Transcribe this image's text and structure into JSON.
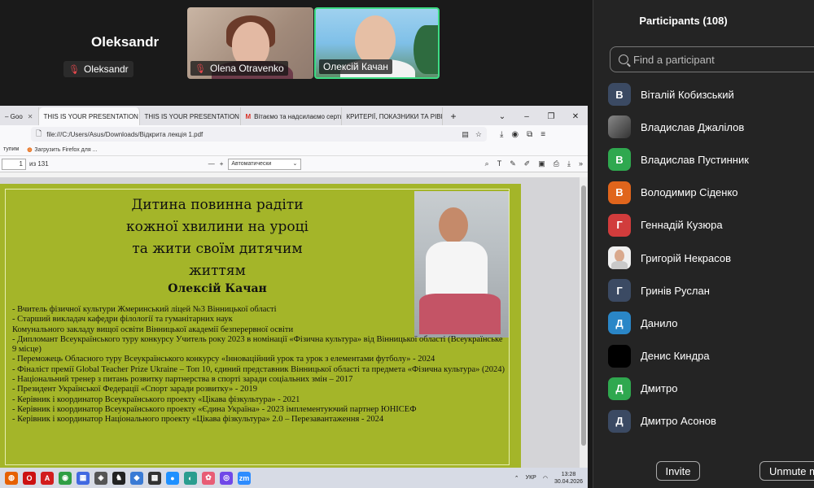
{
  "meeting": {
    "self_name_large": "Oleksandr",
    "self_name_tag": "Oleksandr",
    "tiles": [
      {
        "name": "Olena Otravenko",
        "muted": true
      },
      {
        "name": "Олексій Качан",
        "muted": false,
        "active_speaker": true
      }
    ]
  },
  "browser": {
    "tabs": [
      {
        "label": "– Goo"
      },
      {
        "label": "THIS IS YOUR PRESENTATION TITLE",
        "active": true
      },
      {
        "label": "THIS IS YOUR PRESENTATION TITLE"
      },
      {
        "label": "Вітаємо та надсилаємо сертиф",
        "icon": "M"
      },
      {
        "label": "КРИТЕРІЇ, ПОКАЗНИКИ ТА РІВНІ С"
      }
    ],
    "url": "file:///C:/Users/Asus/Downloads/Відкрита лекція 1.pdf",
    "bookmarks": [
      "тупим",
      "Загрузить Firefox для ..."
    ],
    "pdf": {
      "page_current": "1",
      "page_total": "из 131",
      "zoom": "Автоматически"
    }
  },
  "slide": {
    "title_lines": [
      "Дитина повинна радіти",
      "кожної хвилини на уроці",
      "та жити своїм дитячим",
      "життям"
    ],
    "author": "Олексій Качан",
    "bullets": [
      "- Вчитель фізичної культури Жмеринський ліцей №3 Вінницької області",
      "- Старший викладач кафедри філології та гуманітарних наук",
      "Комунального закладу вищої освіти Вінницької академії безперервної освіти",
      "- Дипломант Всеукраїнського туру конкурсу Учитель року 2023 в номінації «Фізична культура» від Вінницької області (Всеукраїнське 9 місце)",
      "- Переможець Обласного туру Всеукраїнського конкурсу «Інноваційний урок та урок з елементами футболу» - 2024",
      "- Фіналіст премії Global Teacher Prize Ukraine – Топ 10, єдиний представник Вінницької області та предмета «Фізична культура» (2024)",
      "- Національний тренер з питань розвитку партнерства в спорті заради соціальних змін – 2017",
      "- Президент Української Федерації «Спорт заради розвитку» - 2019",
      "- Керівник і координатор Всеукраїнського проекту «Цікава фізкультура» - 2021",
      "- Керівник і координатор Всеукраїнського проекту «Єдина Україна» - 2023 імплементуючий партнер ЮНІСЕФ",
      "- Керівник і координатор Національного проекту «Цікава фізкультура» 2.0 – Перезавантаження - 2024"
    ]
  },
  "taskbar": {
    "lang": "УКР",
    "time": "13:28",
    "date": "30.04.2026"
  },
  "participants": {
    "title": "Participants (108)",
    "search_placeholder": "Find a participant",
    "list": [
      {
        "initial": "В",
        "name": "Віталій Кобизський",
        "color": "#3b4a63"
      },
      {
        "initial": "",
        "name": "Владислав Джалілов",
        "color": "photo1"
      },
      {
        "initial": "В",
        "name": "Владислав Пустинник",
        "color": "#2fa84f"
      },
      {
        "initial": "В",
        "name": "Володимир Сіденко",
        "color": "#e0651c"
      },
      {
        "initial": "Г",
        "name": "Геннадій Кузюра",
        "color": "#d13c3c"
      },
      {
        "initial": "",
        "name": "Григорій Некрасов",
        "color": "photo2"
      },
      {
        "initial": "Г",
        "name": "Гринів Руслан",
        "color": "#3b4a63"
      },
      {
        "initial": "Д",
        "name": "Данило",
        "color": "#2a86c7"
      },
      {
        "initial": "",
        "name": "Денис Киндра",
        "color": "photo3"
      },
      {
        "initial": "Д",
        "name": "Дмитро",
        "color": "#2fa84f"
      },
      {
        "initial": "Д",
        "name": "Дмитро Асонов",
        "color": "#3b4a63"
      }
    ],
    "invite_label": "Invite",
    "unmute_label": "Unmute m"
  }
}
